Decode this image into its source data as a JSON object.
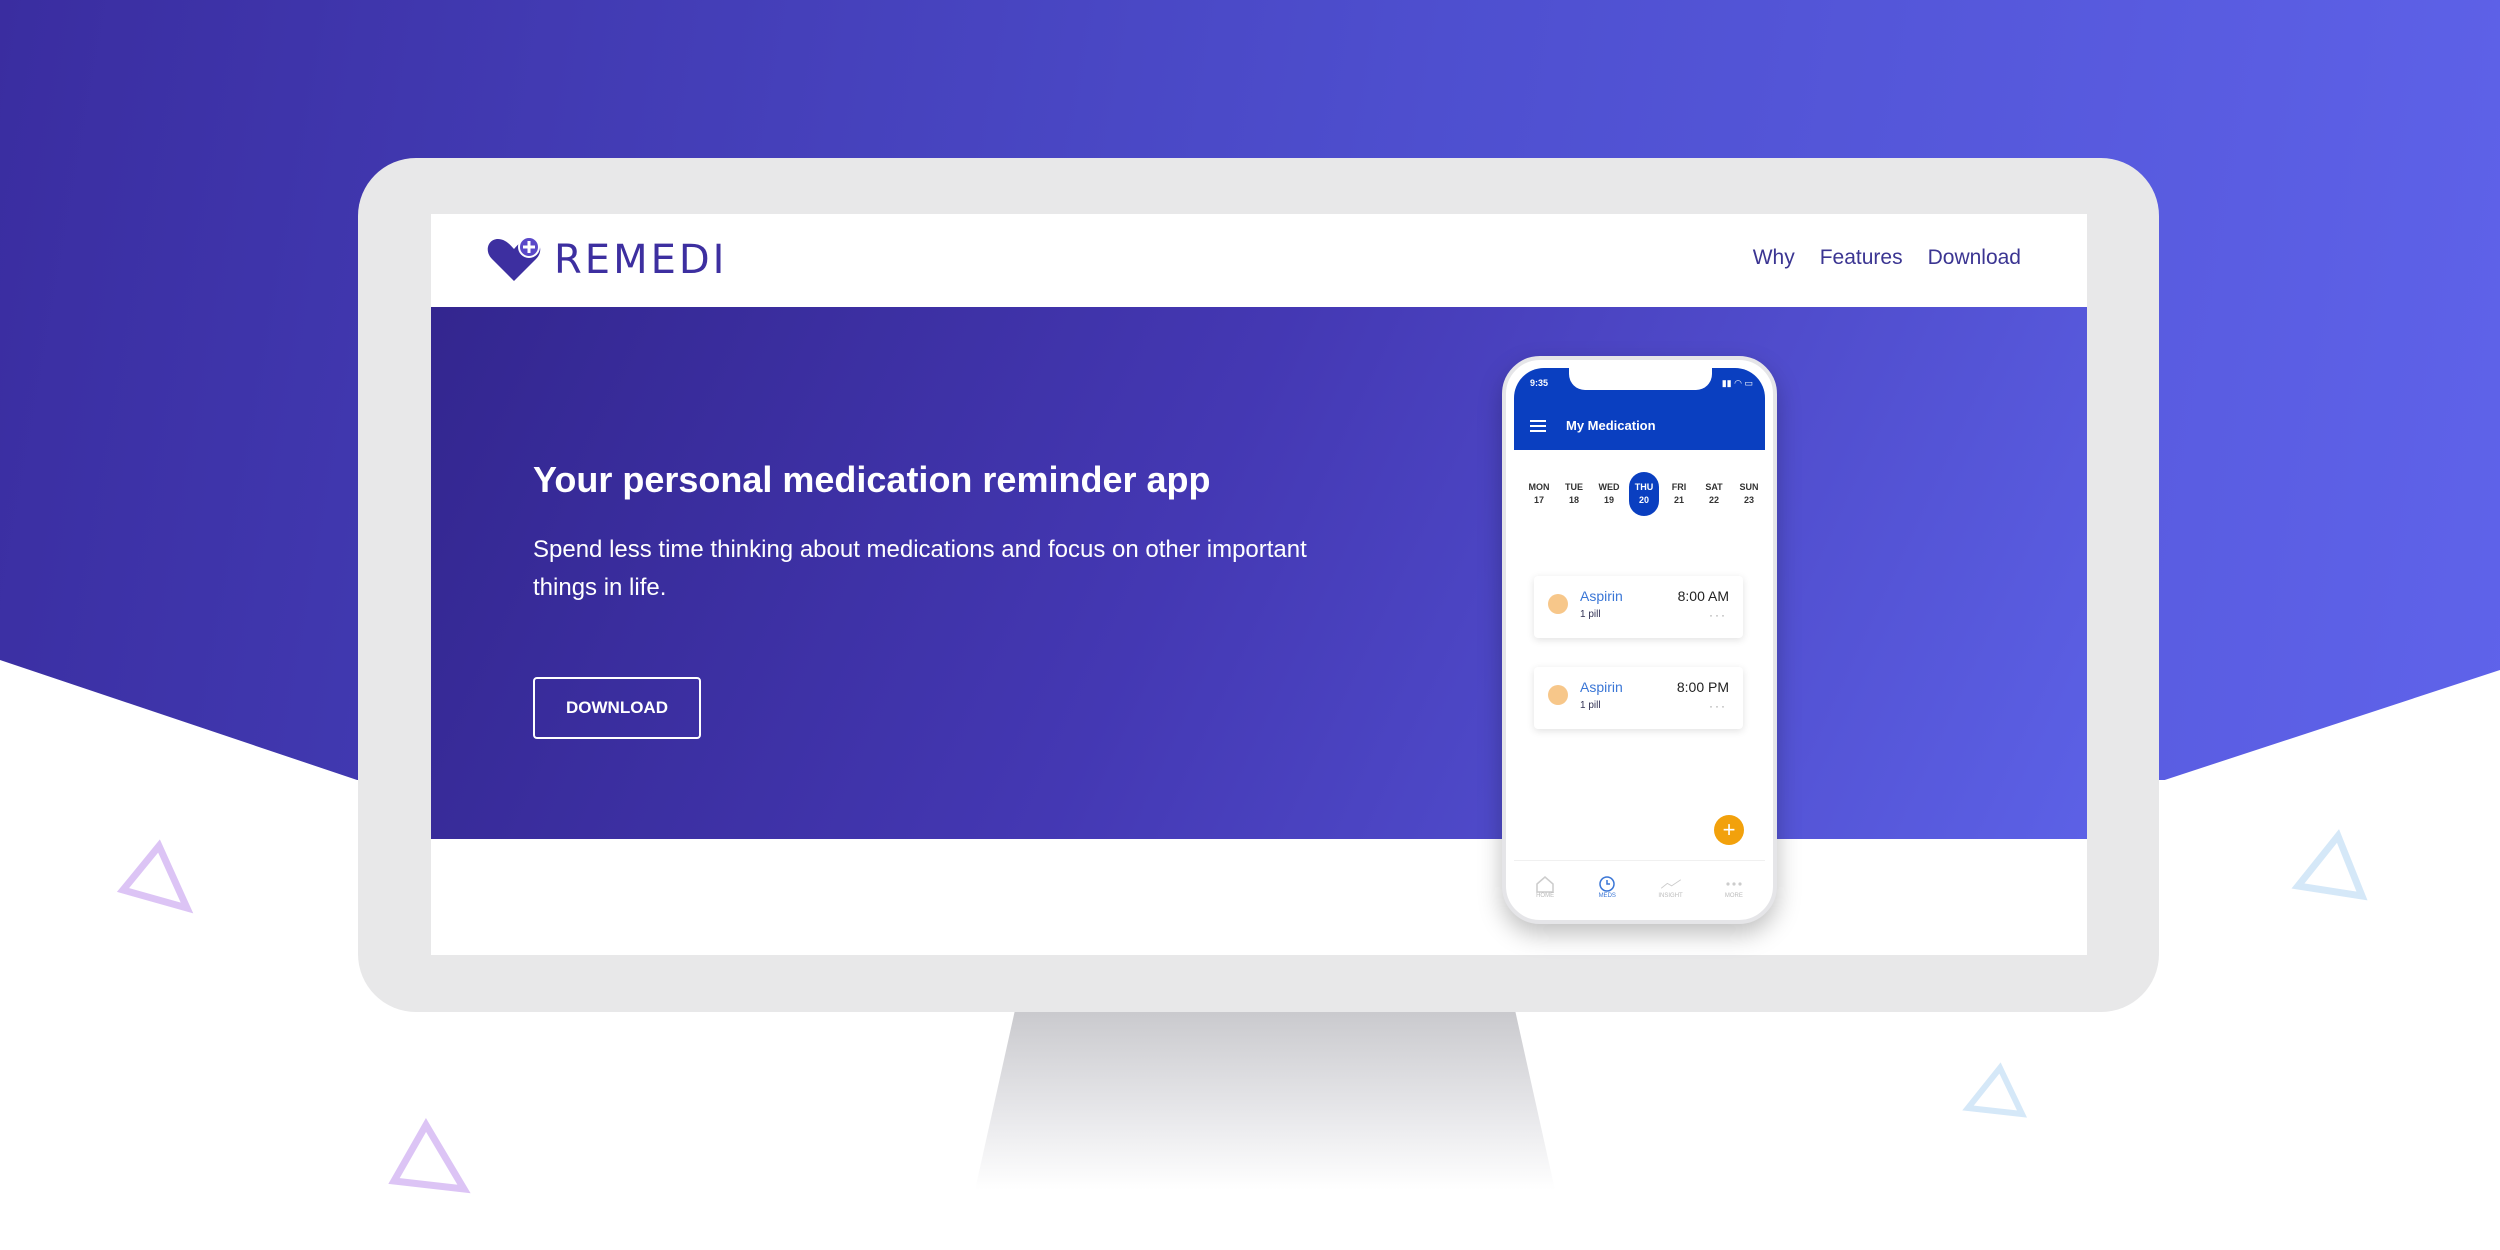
{
  "brand": {
    "name": "REMEDI",
    "accent": "#3d2fa0",
    "hero_gradient": [
      "#33268f",
      "#5c61e6"
    ]
  },
  "nav": {
    "links": [
      "Why",
      "Features",
      "Download"
    ]
  },
  "hero": {
    "title": "Your personal medication reminder app",
    "subtitle": "Spend less time thinking about medications and focus on other important things in life.",
    "button": "DOWNLOAD"
  },
  "phone": {
    "status_time": "9:35",
    "title": "My Medication",
    "days": [
      {
        "name": "MON",
        "num": "17"
      },
      {
        "name": "TUE",
        "num": "18"
      },
      {
        "name": "WED",
        "num": "19"
      },
      {
        "name": "THU",
        "num": "20"
      },
      {
        "name": "FRI",
        "num": "21"
      },
      {
        "name": "SAT",
        "num": "22"
      },
      {
        "name": "SUN",
        "num": "23"
      }
    ],
    "active_day": "THU",
    "meds": [
      {
        "name": "Aspirin",
        "dose": "1 pill",
        "time": "8:00 AM"
      },
      {
        "name": "Aspirin",
        "dose": "1 pill",
        "time": "8:00 PM"
      }
    ],
    "fab": "+",
    "tabs": [
      "HOME",
      "MEDS",
      "INSIGHT",
      "MORE"
    ],
    "active_tab": "MEDS",
    "header_color": "#0a3fc0",
    "fab_color": "#f2a10c"
  }
}
